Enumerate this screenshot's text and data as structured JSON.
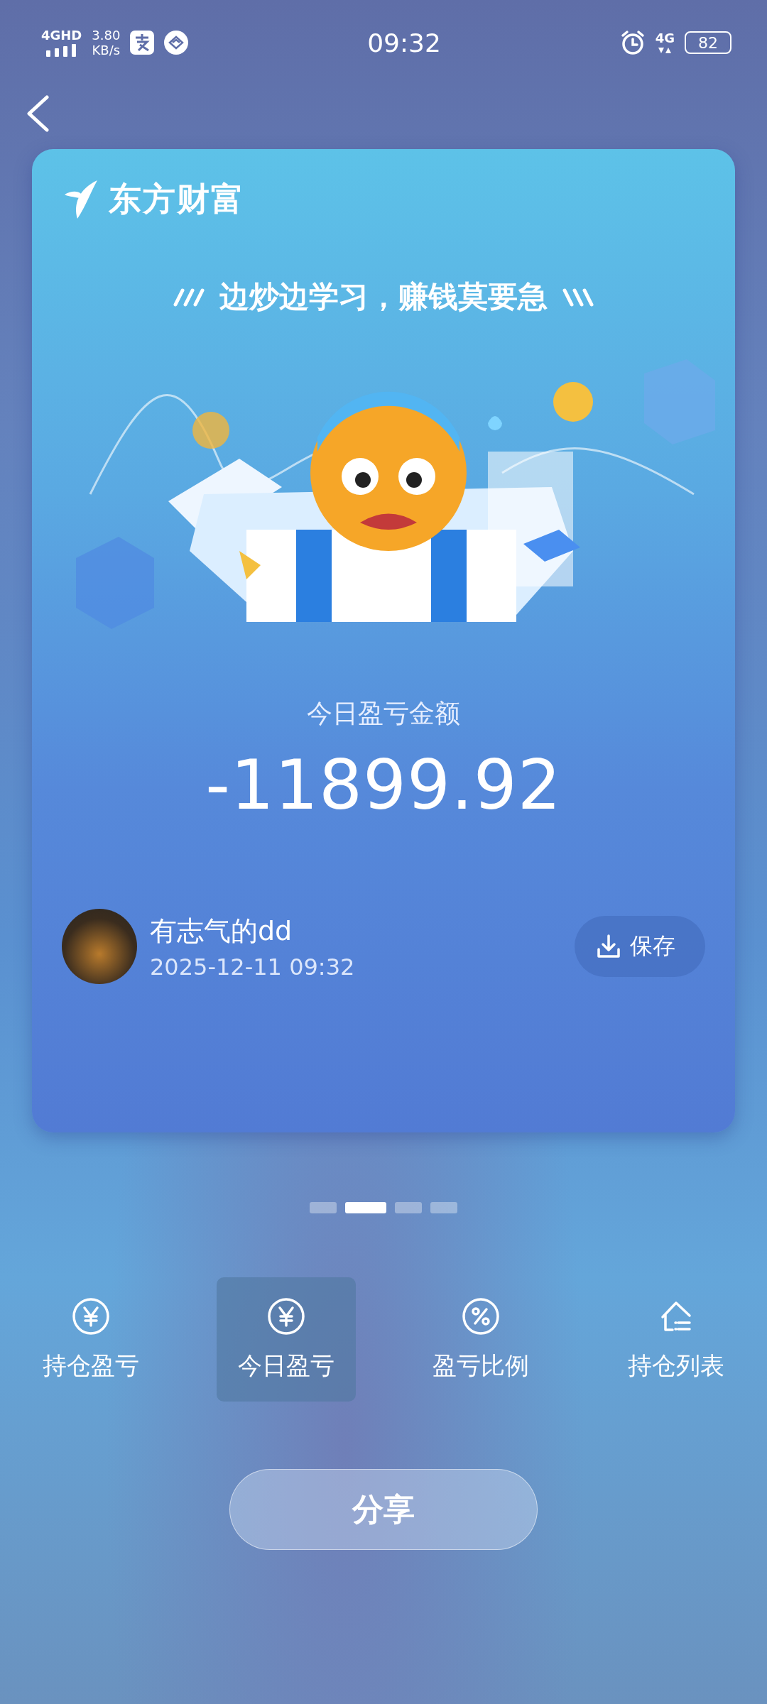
{
  "status_bar": {
    "network": "4GHD",
    "speed_value": "3.80",
    "speed_unit": "KB/s",
    "time": "09:32",
    "mobile_data": "4G",
    "battery": "82"
  },
  "card": {
    "logo_text": "东方财富",
    "slogan": "边炒边学习，赚钱莫要急",
    "amount_label": "今日盈亏金额",
    "amount": "-11899.92",
    "user_name": "有志气的dd",
    "timestamp": "2025-12-11 09:32",
    "save_button": "保存"
  },
  "pager": [
    {
      "selected": false
    },
    {
      "selected": true
    },
    {
      "selected": false
    },
    {
      "selected": false
    }
  ],
  "tabs": [
    {
      "label": "持仓盈亏",
      "kind": "yen",
      "selected": false
    },
    {
      "label": "今日盈亏",
      "kind": "yen",
      "selected": true
    },
    {
      "label": "盈亏比例",
      "kind": "percent",
      "selected": false
    },
    {
      "label": "持仓列表",
      "kind": "list",
      "selected": false
    }
  ],
  "share_button": "分享"
}
